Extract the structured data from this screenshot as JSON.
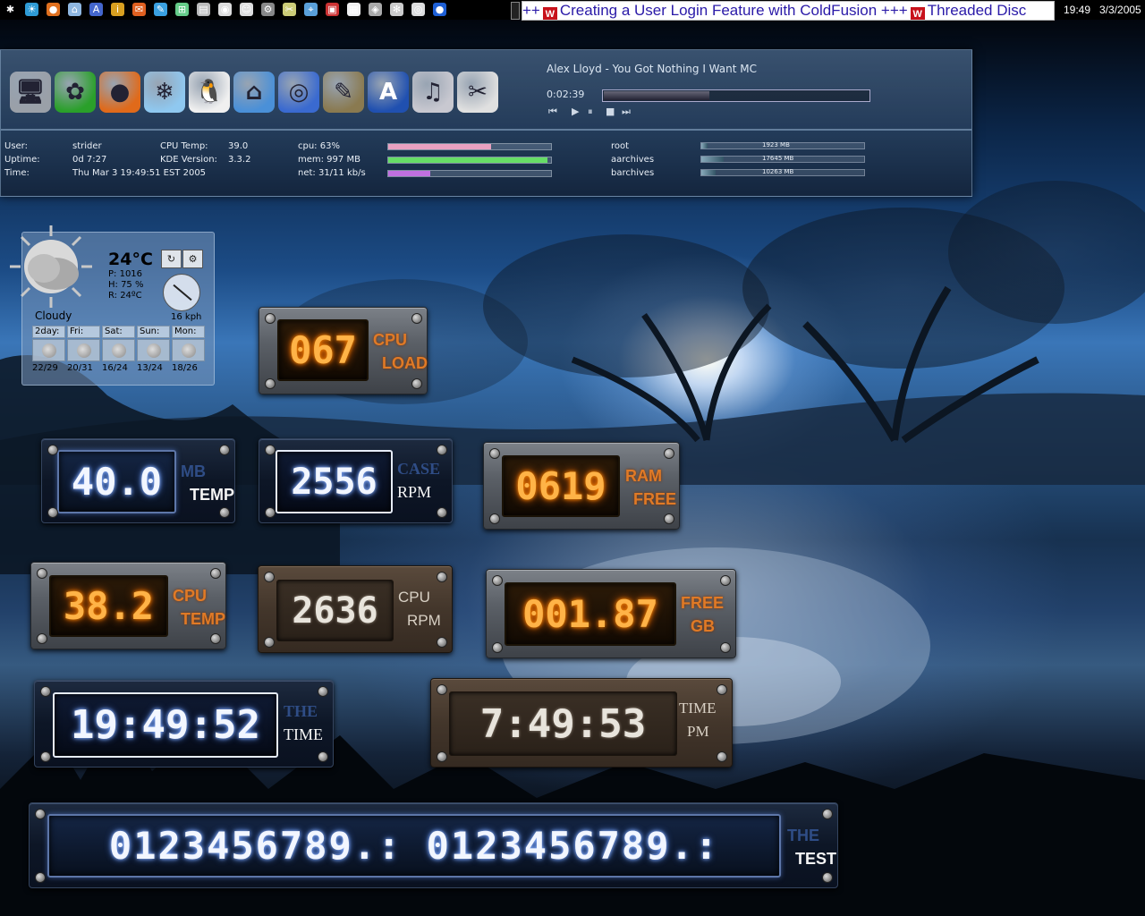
{
  "taskbar": {
    "launcher_icons": [
      "k-menu-icon",
      "kde-icon",
      "firefox-icon",
      "home-icon",
      "kate-icon",
      "kdevelop-icon",
      "mail-icon",
      "editor-icon",
      "network-icon",
      "terminal-icon",
      "konqueror-icon",
      "kopete-icon",
      "kmix-icon",
      "wrench-icon",
      "screenshot-icon",
      "pdf-icon",
      "calculator-icon",
      "settings-icon",
      "gear-icon",
      "cd-icon",
      "globe-icon"
    ],
    "ticker_text_1": "++",
    "ticker_badge": "W",
    "ticker_text_2": "Creating a User Login Feature with ColdFusion +++",
    "ticker_text_3": "Threaded Disc",
    "clock": "19:49",
    "date": "3/3/2005"
  },
  "panel": {
    "apps": [
      "computer-icon",
      "icq-icon",
      "firefox-icon",
      "kmail-icon",
      "tux-icon",
      "home-icon",
      "kde-globe-icon",
      "gimp-icon",
      "kate-icon",
      "juk-icon",
      "pdf-reader-icon"
    ],
    "player": {
      "title": "Alex Lloyd - You Got Nothing I Want MC",
      "time": "0:02:39",
      "progress": 0.4,
      "controls": [
        "⏮",
        "▶",
        "⏸",
        "■",
        "⏭"
      ]
    },
    "stats": {
      "user_label": "User:",
      "user": "strider",
      "uptime_label": "Uptime:",
      "uptime": "0d 7:27",
      "time_label": "Time:",
      "time": "Thu Mar  3 19:49:51 EST 2005",
      "cputemp_label": "CPU Temp:",
      "cputemp": "39.0",
      "kde_label": "KDE Version:",
      "kde": "3.3.2",
      "cpu": "cpu: 63%",
      "mem": "mem: 997 MB",
      "net": "net: 31/11 kb/s",
      "cpu_pct": 0.63,
      "mem_pct": 0.98,
      "net_pct": 0.26,
      "cpu_color": "#e8a0c0",
      "mem_color": "#66dd66",
      "net_color": "#c070e0"
    },
    "disks": [
      {
        "name": "root",
        "value": "1923 MB",
        "pct": 0.04
      },
      {
        "name": "aarchives",
        "value": "17645 MB",
        "pct": 0.14
      },
      {
        "name": "barchives",
        "value": "10263 MB",
        "pct": 0.09
      }
    ]
  },
  "weather": {
    "temp": "24°C",
    "pressure": "P: 1016",
    "humidity": "H: 75 %",
    "realfeel": "R: 24ºC",
    "condition": "Cloudy",
    "wind": "16 kph",
    "forecast": [
      {
        "day": "2day:",
        "temps": "22/29"
      },
      {
        "day": "Fri:",
        "temps": "20/31"
      },
      {
        "day": "Sat:",
        "temps": "16/24"
      },
      {
        "day": "Sun:",
        "temps": "13/24"
      },
      {
        "day": "Mon:",
        "temps": "18/26"
      }
    ]
  },
  "widgets": {
    "cpu_load": {
      "value": "067",
      "label1": "CPU",
      "label2": "LOAD"
    },
    "mb_temp": {
      "value": "40.0",
      "label1": "MB",
      "label2": "TEMP"
    },
    "case_rpm": {
      "value": "2556",
      "label1": "CASE",
      "label2": "RPM"
    },
    "ram_free": {
      "value": "0619",
      "label1": "RAM",
      "label2": "FREE"
    },
    "cpu_temp": {
      "value": "38.2",
      "label1": "CPU",
      "label2": "TEMP"
    },
    "cpu_rpm": {
      "value": "2636",
      "label1": "CPU",
      "label2": "RPM"
    },
    "free_gb": {
      "value": "001.87",
      "label1": "FREE",
      "label2": "GB"
    },
    "time_24": {
      "value": "19:49:52",
      "label1": "THE",
      "label2": "TIME"
    },
    "time_12": {
      "value": "7:49:53",
      "label1": "TIME",
      "label2": "PM"
    },
    "test": {
      "value": "0123456789.: 0123456789.:",
      "label1": "THE",
      "label2": "TEST"
    }
  },
  "colors": {
    "accent_orange": "#ffb347",
    "accent_blue": "#8fb4ff"
  }
}
